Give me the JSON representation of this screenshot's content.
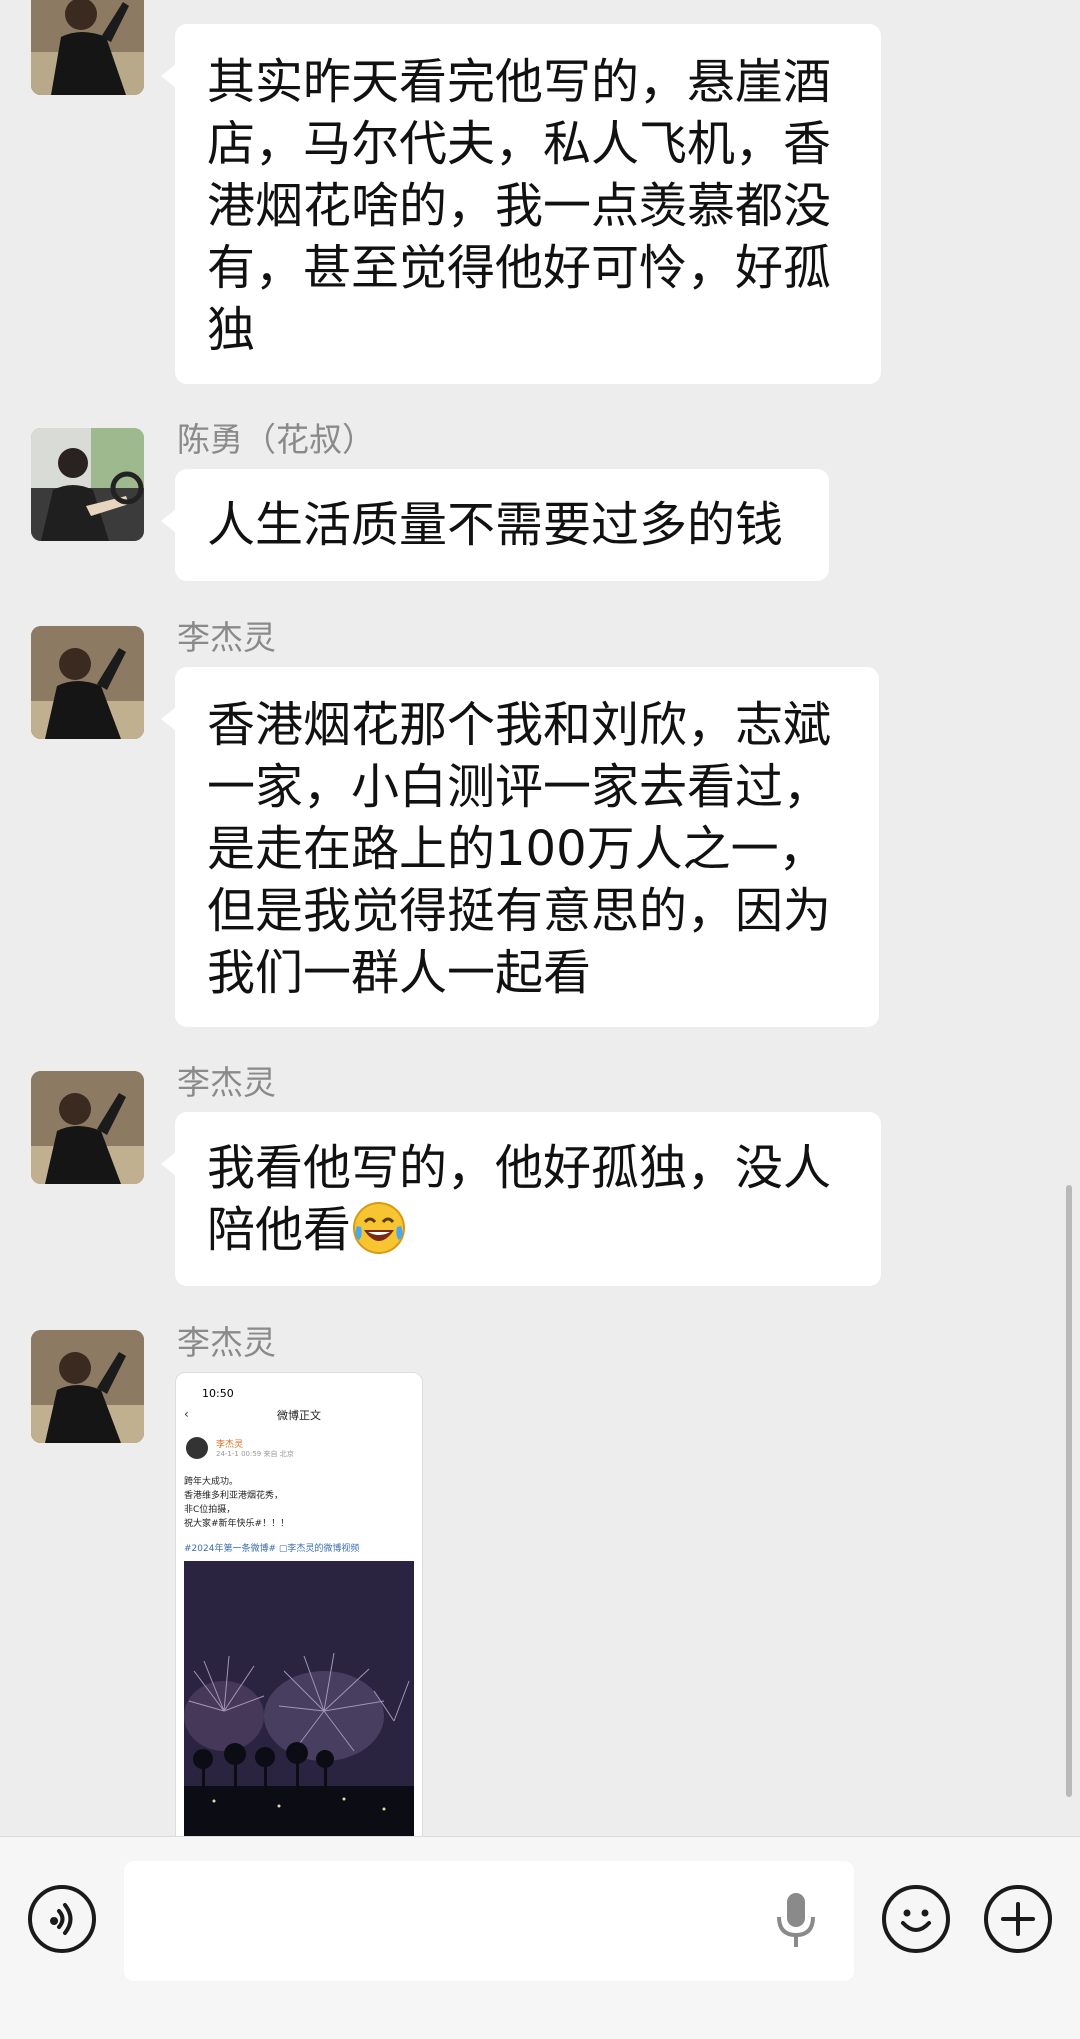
{
  "messages": [
    {
      "sender": "",
      "text": "其实昨天看完他写的，悬崖酒\n店，马尔代夫，私人飞机，香\n港烟花啥的，我一点羡慕都没\n有，甚至觉得他好可怜，好孤\n独"
    },
    {
      "sender": "陈勇（花叔）",
      "text": "人生活质量不需要过多的钱"
    },
    {
      "sender": "李杰灵",
      "text": "香港烟花那个我和刘欣，志斌\n一家，小白测评一家去看过，\n是走在路上的100万人之一，\n但是我觉得挺有意思的，因为\n我们一群人一起看"
    },
    {
      "sender": "李杰灵",
      "text": "我看他写的，他好孤独，没人\n陪他看"
    },
    {
      "sender": "李杰灵",
      "image": {
        "status_time": "10:50",
        "nav_title": "微博正文",
        "post_user": "李杰灵",
        "post_meta": "24-1-1 00:59  来自 北京",
        "post_text": "跨年大成功。\n香港维多利亚港烟花秀，\n非C位拍摄，\n祝大家#新年快乐#！！！",
        "post_tag": "#2024年第一条微博#  ▢李杰灵的微博视频"
      }
    }
  ],
  "colors": {
    "background": "#ededed",
    "bubble": "#ffffff",
    "sender": "#8a8a8a"
  },
  "icons": [
    "voice-mode-icon",
    "microphone-icon",
    "emoji-icon",
    "plus-icon",
    "laughing-crying-emoji"
  ]
}
